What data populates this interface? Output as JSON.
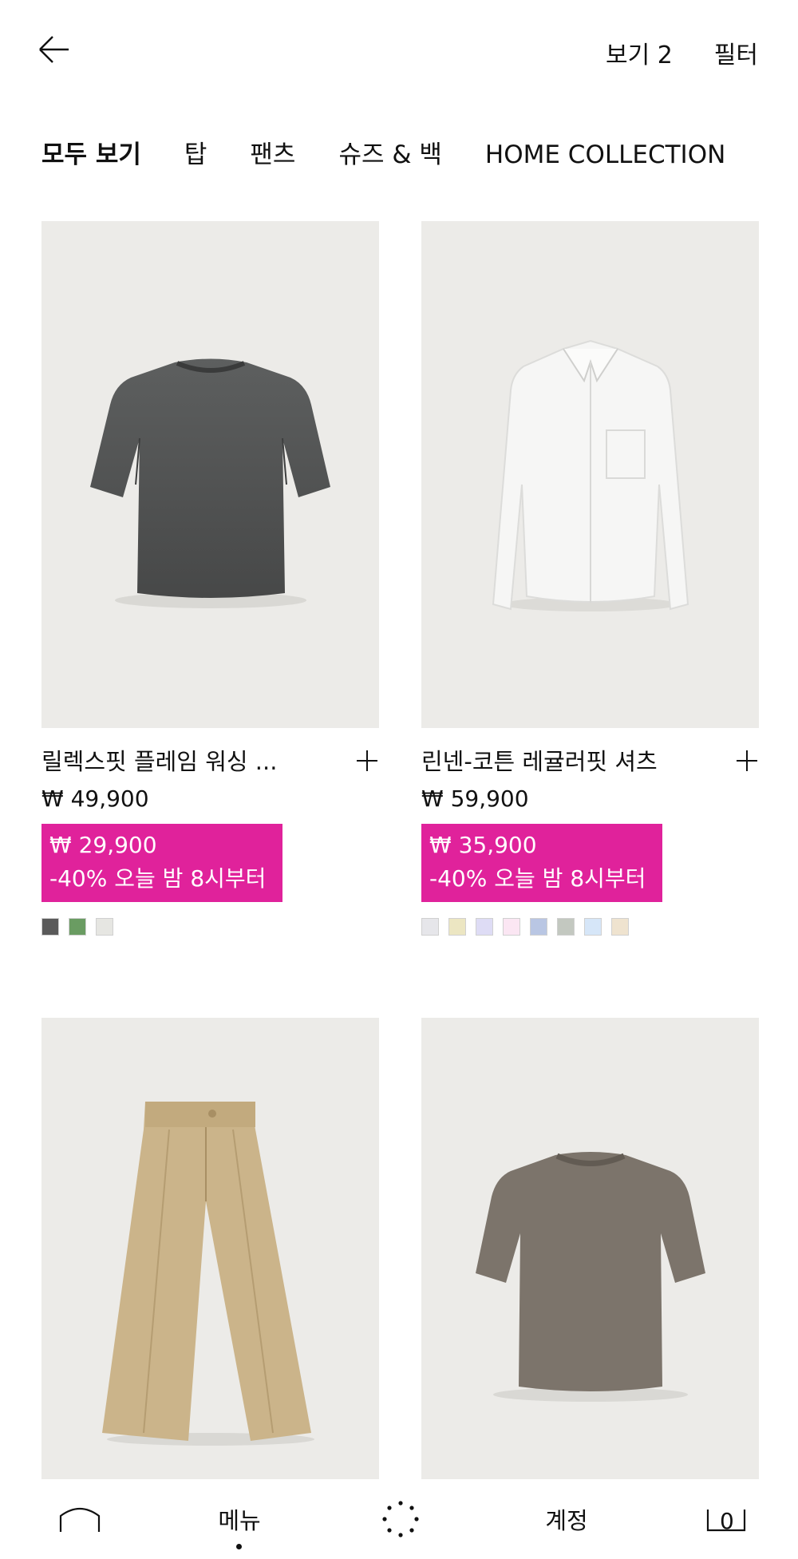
{
  "header": {
    "view_label": "보기 2",
    "filter_label": "필터"
  },
  "tabs": [
    {
      "label": "모두 보기",
      "active": true
    },
    {
      "label": "탑",
      "active": false
    },
    {
      "label": "팬츠",
      "active": false
    },
    {
      "label": "슈즈 & 백",
      "active": false
    },
    {
      "label": "HOME COLLECTION",
      "active": false
    }
  ],
  "products": [
    {
      "name": "릴렉스핏 플레임 워싱 ...",
      "price": "₩ 49,900",
      "sale_price": "₩ 29,900",
      "sale_note": "-40% 오늘 밤 8시부터",
      "swatches": [
        "#5a5a5a",
        "#6a9c62",
        "#e6e6e2"
      ],
      "image": "charcoal-tshirt"
    },
    {
      "name": "린넨-코튼 레귤러핏 셔츠",
      "price": "₩ 59,900",
      "sale_price": "₩ 35,900",
      "sale_note": "-40% 오늘 밤 8시부터",
      "swatches": [
        "#e6e6ea",
        "#ece6c2",
        "#dedcf5",
        "#fbe6f3",
        "#b9c6e3",
        "#c3c8c0",
        "#d6e6f8",
        "#efe3cf"
      ],
      "image": "white-shirt"
    },
    {
      "image": "beige-pants"
    },
    {
      "image": "taupe-tshirt"
    }
  ],
  "bottom_nav": {
    "menu_label": "메뉴",
    "account_label": "계정",
    "cart_count": "0"
  },
  "colors": {
    "sale_bg": "#e0229b",
    "image_bg": "#ecebe8"
  }
}
